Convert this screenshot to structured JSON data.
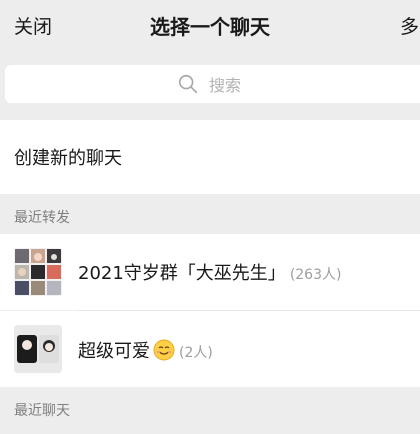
{
  "nav": {
    "close_label": "关闭",
    "title": "选择一个聊天",
    "multi_select_label": "多"
  },
  "search": {
    "placeholder": "搜索"
  },
  "create_chat": {
    "label": "创建新的聊天"
  },
  "recent_forward": {
    "header": "最近转发",
    "items": [
      {
        "name": "2021守岁群「大巫先生」",
        "count": "(263人)",
        "avatar": "group-collage-avatar"
      },
      {
        "name": "超级可爱",
        "count": "(2人)",
        "emoji": "smiling-face-emoji",
        "avatar": "pair-avatar"
      }
    ]
  },
  "recent_chats": {
    "header": "最近聊天"
  },
  "colors": {
    "background": "#ededed",
    "surface": "#ffffff",
    "text": "#191919",
    "secondary_text": "#7f7f7f",
    "placeholder": "#b2b2b2"
  }
}
